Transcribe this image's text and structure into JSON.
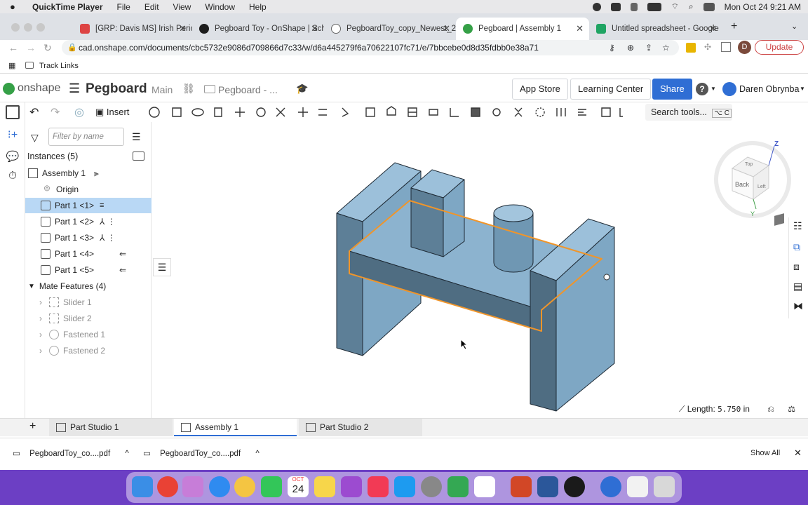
{
  "menubar": {
    "app": "QuickTime Player",
    "items": [
      "File",
      "Edit",
      "View",
      "Window",
      "Help"
    ],
    "datetime": "Mon Oct 24  9:21 AM"
  },
  "browser": {
    "tabs": [
      {
        "title": "[GRP: Davis MS] Irish Period T",
        "fav": "#d44"
      },
      {
        "title": "Pegboard Toy - OnShape | Sch",
        "fav": "#1d1d1d"
      },
      {
        "title": "PegboardToy_copy_Newest_2",
        "fav": "#ffffff"
      },
      {
        "title": "Pegboard | Assembly 1",
        "fav": "#35a047"
      },
      {
        "title": "Untitled spreadsheet - Google",
        "fav": "#1fa463"
      }
    ],
    "url": "cad.onshape.com/documents/cbc5732e9086d709866d7c33/w/d6a445279f6a70622107fc71/e/7bbcebe0d8d35fdbb0e38a71",
    "update_label": "Update",
    "avatar_letter": "D",
    "bookmark": "Track Links"
  },
  "onshape": {
    "logo": "onshape",
    "doc_title": "Pegboard",
    "branch": "Main",
    "folder": "Pegboard - ...",
    "app_store": "App Store",
    "learning_center": "Learning Center",
    "share": "Share",
    "user": "Daren Obrynba",
    "insert": "Insert",
    "search_tools": "Search tools...",
    "search_shortcut": "⌥ C"
  },
  "panel": {
    "filter_placeholder": "Filter by name",
    "instances_header": "Instances (5)",
    "assembly": "Assembly 1",
    "origin": "Origin",
    "parts": [
      "Part 1 <1>",
      "Part 1 <2>",
      "Part 1 <3>",
      "Part 1 <4>",
      "Part 1 <5>"
    ],
    "mate_header": "Mate Features (4)",
    "mates": [
      "Slider 1",
      "Slider 2",
      "Fastened 1",
      "Fastened 2"
    ]
  },
  "viewcube": {
    "labels": [
      "Back",
      "Left",
      "Top"
    ],
    "axes": [
      "Z",
      "Y"
    ]
  },
  "measure": {
    "label": "Length:",
    "value": "5.750",
    "unit": "in"
  },
  "bottom_tabs": [
    "Part Studio 1",
    "Assembly 1",
    "Part Studio 2"
  ],
  "downloads": {
    "files": [
      "PegboardToy_co....pdf",
      "PegboardToy_co....pdf"
    ],
    "show_all": "Show All"
  },
  "dock_date": {
    "month": "OCT",
    "day": "24"
  },
  "colors": {
    "accent": "#2f6ed4",
    "selection": "#f0952a",
    "part": "#7fa8c5",
    "dock": "#6c3fc4"
  }
}
